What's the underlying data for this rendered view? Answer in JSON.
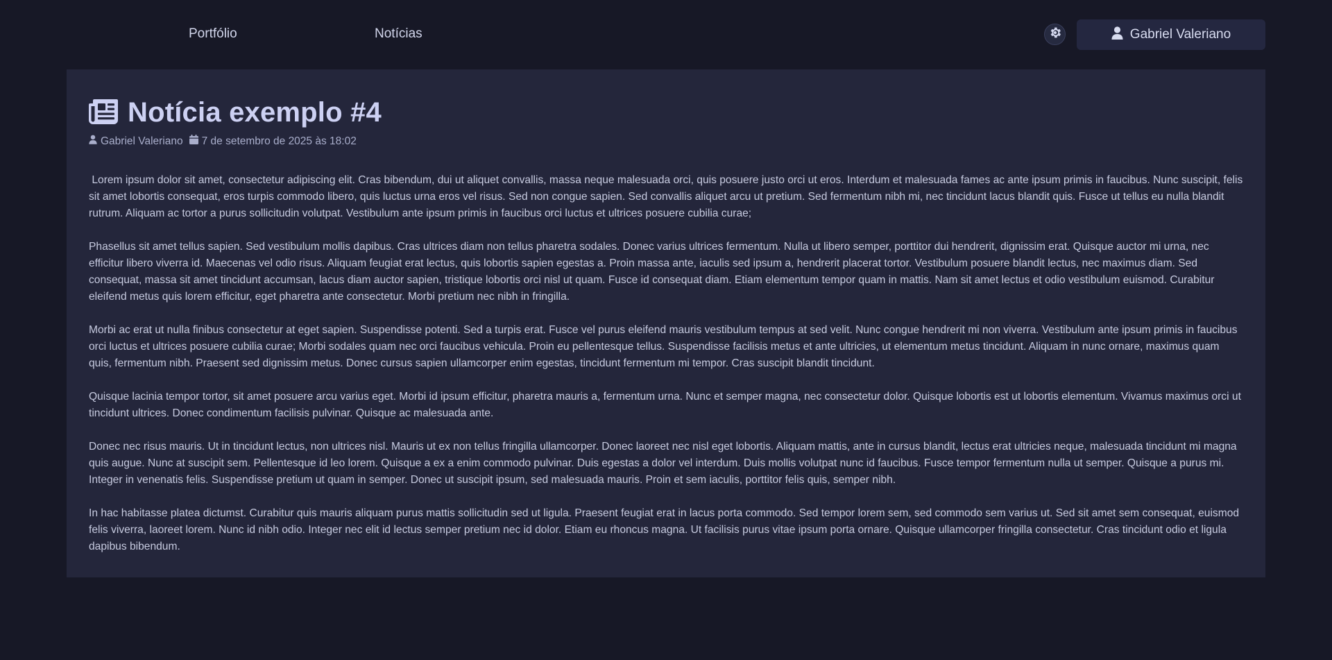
{
  "nav": {
    "links": [
      "Portfólio",
      "Notícias"
    ]
  },
  "theme_toggle": {
    "icon": "gear-icon"
  },
  "user": {
    "name": "Gabriel Valeriano",
    "icon": "user-icon"
  },
  "article": {
    "icon": "newspaper-icon",
    "title": "Notícia exemplo #4",
    "author": "Gabriel Valeriano",
    "date": "7 de setembro de 2025 às 18:02",
    "paragraphs": [
      " Lorem ipsum dolor sit amet, consectetur adipiscing elit. Cras bibendum, dui ut aliquet convallis, massa neque malesuada orci, quis posuere justo orci ut eros. Interdum et malesuada fames ac ante ipsum primis in faucibus. Nunc suscipit, felis sit amet lobortis consequat, eros turpis commodo libero, quis luctus urna eros vel risus. Sed non congue sapien. Sed convallis aliquet arcu ut pretium. Sed fermentum nibh mi, nec tincidunt lacus blandit quis. Fusce ut tellus eu nulla blandit rutrum. Aliquam ac tortor a purus sollicitudin volutpat. Vestibulum ante ipsum primis in faucibus orci luctus et ultrices posuere cubilia curae;",
      "Phasellus sit amet tellus sapien. Sed vestibulum mollis dapibus. Cras ultrices diam non tellus pharetra sodales. Donec varius ultrices fermentum. Nulla ut libero semper, porttitor dui hendrerit, dignissim erat. Quisque auctor mi urna, nec efficitur libero viverra id. Maecenas vel odio risus. Aliquam feugiat erat lectus, quis lobortis sapien egestas a. Proin massa ante, iaculis sed ipsum a, hendrerit placerat tortor. Vestibulum posuere blandit lectus, nec maximus diam. Sed consequat, massa sit amet tincidunt accumsan, lacus diam auctor sapien, tristique lobortis orci nisl ut quam. Fusce id consequat diam. Etiam elementum tempor quam in mattis. Nam sit amet lectus et odio vestibulum euismod. Curabitur eleifend metus quis lorem efficitur, eget pharetra ante consectetur. Morbi pretium nec nibh in fringilla.",
      "Morbi ac erat ut nulla finibus consectetur at eget sapien. Suspendisse potenti. Sed a turpis erat. Fusce vel purus eleifend mauris vestibulum tempus at sed velit. Nunc congue hendrerit mi non viverra. Vestibulum ante ipsum primis in faucibus orci luctus et ultrices posuere cubilia curae; Morbi sodales quam nec orci faucibus vehicula. Proin eu pellentesque tellus. Suspendisse facilisis metus et ante ultricies, ut elementum metus tincidunt. Aliquam in nunc ornare, maximus quam quis, fermentum nibh. Praesent sed dignissim metus. Donec cursus sapien ullamcorper enim egestas, tincidunt fermentum mi tempor. Cras suscipit blandit tincidunt.",
      "Quisque lacinia tempor tortor, sit amet posuere arcu varius eget. Morbi id ipsum efficitur, pharetra mauris a, fermentum urna. Nunc et semper magna, nec consectetur dolor. Quisque lobortis est ut lobortis elementum. Vivamus maximus orci ut tincidunt ultrices. Donec condimentum facilisis pulvinar. Quisque ac malesuada ante.",
      "Donec nec risus mauris. Ut in tincidunt lectus, non ultrices nisl. Mauris ut ex non tellus fringilla ullamcorper. Donec laoreet nec nisl eget lobortis. Aliquam mattis, ante in cursus blandit, lectus erat ultricies neque, malesuada tincidunt mi magna quis augue. Nunc at suscipit sem. Pellentesque id leo lorem. Quisque a ex a enim commodo pulvinar. Duis egestas a dolor vel interdum. Duis mollis volutpat nunc id faucibus. Fusce tempor fermentum nulla ut semper. Quisque a purus mi. Integer in venenatis felis. Suspendisse pretium ut quam in semper. Donec ut suscipit ipsum, sed malesuada mauris. Proin et sem iaculis, porttitor felis quis, semper nibh.",
      "In hac habitasse platea dictumst. Curabitur quis mauris aliquam purus mattis sollicitudin sed ut ligula. Praesent feugiat erat in lacus porta commodo. Sed tempor lorem sem, sed commodo sem varius ut. Sed sit amet sem consequat, euismod felis viverra, laoreet lorem. Nunc id nibh odio. Integer nec elit id lectus semper pretium nec id dolor. Etiam eu rhoncus magna. Ut facilisis purus vitae ipsum porta ornare. Quisque ullamcorper fringilla consectetur. Cras tincidunt odio et ligula dapibus bibendum."
    ]
  }
}
